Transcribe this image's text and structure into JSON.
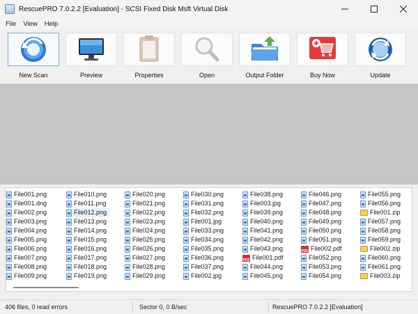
{
  "window": {
    "title": "RescuePRO 7.0.2.2 [Evaluation] - SCSI Fixed Disk Msft Virtual Disk"
  },
  "menu": [
    "File",
    "View",
    "Help"
  ],
  "toolbar": [
    {
      "label": "New Scan",
      "icon": "new-scan-icon"
    },
    {
      "label": "Preview",
      "icon": "monitor-icon"
    },
    {
      "label": "Properties",
      "icon": "clipboard-icon"
    },
    {
      "label": "Open",
      "icon": "magnifier-icon"
    },
    {
      "label": "Output Folder",
      "icon": "folder-icon"
    },
    {
      "label": "Buy Now",
      "icon": "cart-icon"
    },
    {
      "label": "Update",
      "icon": "update-icon"
    }
  ],
  "files": {
    "columns": [
      [
        {
          "name": "File001.png",
          "type": "img"
        },
        {
          "name": "File001.dng",
          "type": "img"
        },
        {
          "name": "File002.png",
          "type": "img"
        },
        {
          "name": "File003.png",
          "type": "img"
        },
        {
          "name": "File004.png",
          "type": "img"
        },
        {
          "name": "File005.png",
          "type": "img"
        },
        {
          "name": "File006.png",
          "type": "img"
        },
        {
          "name": "File007.png",
          "type": "img"
        },
        {
          "name": "File008.png",
          "type": "img"
        },
        {
          "name": "File009.png",
          "type": "img"
        }
      ],
      [
        {
          "name": "File010.png",
          "type": "img"
        },
        {
          "name": "File011.png",
          "type": "img"
        },
        {
          "name": "File012.png",
          "type": "img"
        },
        {
          "name": "File013.png",
          "type": "img"
        },
        {
          "name": "File014.png",
          "type": "img"
        },
        {
          "name": "File015.png",
          "type": "img"
        },
        {
          "name": "File016.png",
          "type": "img"
        },
        {
          "name": "File017.png",
          "type": "img"
        },
        {
          "name": "File018.png",
          "type": "img"
        },
        {
          "name": "File019.png",
          "type": "img"
        }
      ],
      [
        {
          "name": "File020.png",
          "type": "img"
        },
        {
          "name": "File021.png",
          "type": "img"
        },
        {
          "name": "File022.png",
          "type": "img"
        },
        {
          "name": "File023.png",
          "type": "img"
        },
        {
          "name": "File024.png",
          "type": "img"
        },
        {
          "name": "File025.png",
          "type": "img"
        },
        {
          "name": "File026.png",
          "type": "img"
        },
        {
          "name": "File027.png",
          "type": "img"
        },
        {
          "name": "File028.png",
          "type": "img"
        },
        {
          "name": "File029.png",
          "type": "img"
        }
      ],
      [
        {
          "name": "File030.png",
          "type": "img"
        },
        {
          "name": "File031.png",
          "type": "img"
        },
        {
          "name": "File032.png",
          "type": "img"
        },
        {
          "name": "File001.jpg",
          "type": "img"
        },
        {
          "name": "File033.png",
          "type": "img"
        },
        {
          "name": "File034.png",
          "type": "img"
        },
        {
          "name": "File035.png",
          "type": "img"
        },
        {
          "name": "File036.png",
          "type": "img"
        },
        {
          "name": "File037.png",
          "type": "img"
        },
        {
          "name": "File002.jpg",
          "type": "img"
        }
      ],
      [
        {
          "name": "File038.png",
          "type": "img"
        },
        {
          "name": "File003.jpg",
          "type": "img"
        },
        {
          "name": "File039.png",
          "type": "img"
        },
        {
          "name": "File040.png",
          "type": "img"
        },
        {
          "name": "File041.png",
          "type": "img"
        },
        {
          "name": "File042.png",
          "type": "img"
        },
        {
          "name": "File043.png",
          "type": "img"
        },
        {
          "name": "File001.pdf",
          "type": "pdf"
        },
        {
          "name": "File044.png",
          "type": "img"
        },
        {
          "name": "File045.png",
          "type": "img"
        }
      ],
      [
        {
          "name": "File046.png",
          "type": "img"
        },
        {
          "name": "File047.png",
          "type": "img"
        },
        {
          "name": "File048.png",
          "type": "img"
        },
        {
          "name": "File049.png",
          "type": "img"
        },
        {
          "name": "File050.png",
          "type": "img"
        },
        {
          "name": "File051.png",
          "type": "img"
        },
        {
          "name": "File002.pdf",
          "type": "pdf"
        },
        {
          "name": "File052.png",
          "type": "img"
        },
        {
          "name": "File053.png",
          "type": "img"
        },
        {
          "name": "File054.png",
          "type": "img"
        }
      ],
      [
        {
          "name": "File055.png",
          "type": "img"
        },
        {
          "name": "File056.png",
          "type": "img"
        },
        {
          "name": "File001.zip",
          "type": "zip"
        },
        {
          "name": "File057.png",
          "type": "img"
        },
        {
          "name": "File058.png",
          "type": "img"
        },
        {
          "name": "File059.png",
          "type": "img"
        },
        {
          "name": "File002.zip",
          "type": "zip"
        },
        {
          "name": "File060.png",
          "type": "img"
        },
        {
          "name": "File061.png",
          "type": "img"
        },
        {
          "name": "File003.zip",
          "type": "zip"
        }
      ]
    ],
    "hovered": "File012.png",
    "pdf_badge": "PDF"
  },
  "status": {
    "left": "406 files, 0 read errors",
    "center": "Sector 0, 0 B/sec",
    "right": "RescuePRO 7.0.2.2 [Evaluation]"
  }
}
